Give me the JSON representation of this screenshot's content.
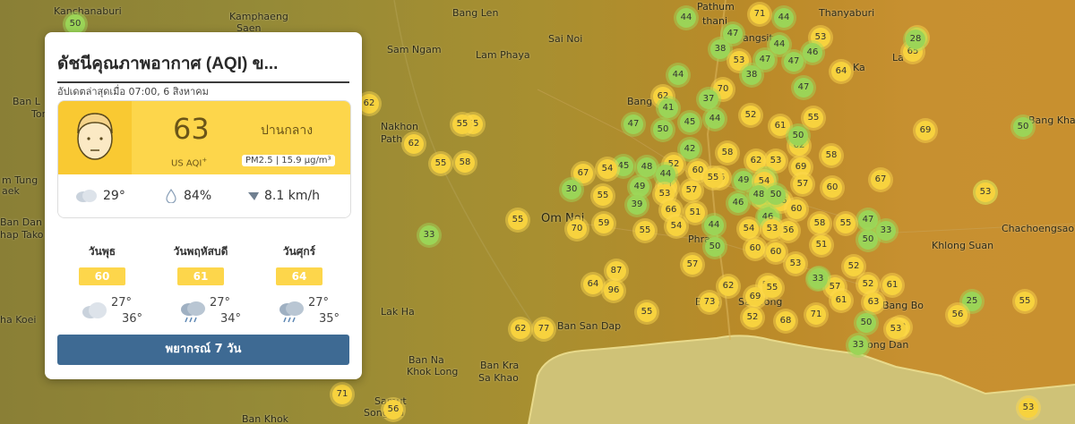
{
  "card": {
    "title": "ดัชนีคุณภาพอากาศ (AQI) ข...",
    "updated": "อัปเดตล่าสุดเมื่อ 07:00, 6 สิงหาคม",
    "aqi_value": "63",
    "aqi_unit": "US AQI",
    "aqi_unit_sup": "+",
    "aqi_level": "ปานกลาง",
    "pm_label": "PM2.5 | 15.9 µg/m³",
    "temperature": "29°",
    "humidity": "84%",
    "wind": "8.1 km/h",
    "forecast": [
      {
        "day": "วันพุธ",
        "aqi": "60",
        "high": "27°",
        "low": "36°",
        "icon": "cloud-icon"
      },
      {
        "day": "วันพฤหัสบดี",
        "aqi": "61",
        "high": "27°",
        "low": "34°",
        "icon": "rain-icon"
      },
      {
        "day": "วันศุกร์",
        "aqi": "64",
        "high": "27°",
        "low": "35°",
        "icon": "rain-icon"
      }
    ],
    "forecast_button": "พยากรณ์ 7 วัน",
    "colors": {
      "moderate": "#fdd64b",
      "good": "#9bd457",
      "button": "#3e6a93"
    }
  },
  "places": [
    {
      "name": "Kanchanaburi"
    },
    {
      "name": "Kamphaeng"
    },
    {
      "name": "Saen"
    },
    {
      "name": "Bang Len"
    },
    {
      "name": "Sam Ngam"
    },
    {
      "name": "Lam Phaya"
    },
    {
      "name": "Sai Noi"
    },
    {
      "name": "Pathum"
    },
    {
      "name": "thani"
    },
    {
      "name": "Thanyaburi"
    },
    {
      "name": "angsit"
    },
    {
      "name": "La"
    },
    {
      "name": "Ka"
    },
    {
      "name": "Ban L"
    },
    {
      "name": "Ton"
    },
    {
      "name": "Nakhon"
    },
    {
      "name": "Path"
    },
    {
      "name": "Bang P"
    },
    {
      "name": "Bang Khan"
    },
    {
      "name": "m Tung"
    },
    {
      "name": "aek"
    },
    {
      "name": "Ban Dan"
    },
    {
      "name": "hap Tako"
    },
    {
      "name": "Om Noi"
    },
    {
      "name": "Chachoengsao"
    },
    {
      "name": "Khlong Suan"
    },
    {
      "name": "ha Koei"
    },
    {
      "name": "Lak Ha"
    },
    {
      "name": "Ban San Dap"
    },
    {
      "name": "Bang Bo"
    },
    {
      "name": "ong Dan"
    },
    {
      "name": "Ban Na"
    },
    {
      "name": "Khok Long"
    },
    {
      "name": "Ban Kra"
    },
    {
      "name": "Sa Khao"
    },
    {
      "name": "Samut"
    },
    {
      "name": "Songkra"
    },
    {
      "name": "Ban Khok"
    },
    {
      "name": "Phra"
    },
    {
      "name": "Samrong"
    },
    {
      "name": "Bang"
    }
  ],
  "markers": [
    {
      "v": "50",
      "c": "g"
    },
    {
      "v": "44",
      "c": "g"
    },
    {
      "v": "71",
      "c": "m"
    },
    {
      "v": "44",
      "c": "g"
    },
    {
      "v": "47",
      "c": "g"
    },
    {
      "v": "44",
      "c": "g"
    },
    {
      "v": "53",
      "c": "m"
    },
    {
      "v": "38",
      "c": "g"
    },
    {
      "v": "53",
      "c": "m"
    },
    {
      "v": "47",
      "c": "g"
    },
    {
      "v": "38",
      "c": "g"
    },
    {
      "v": "47",
      "c": "g"
    },
    {
      "v": "46",
      "c": "g"
    },
    {
      "v": "64",
      "c": "m"
    },
    {
      "v": "65",
      "c": "m"
    },
    {
      "v": "44",
      "c": "g"
    },
    {
      "v": "70",
      "c": "m"
    },
    {
      "v": "47",
      "c": "g"
    },
    {
      "v": "62",
      "c": "m"
    },
    {
      "v": "37",
      "c": "g"
    },
    {
      "v": "41",
      "c": "g"
    },
    {
      "v": "44",
      "c": "g"
    },
    {
      "v": "52",
      "c": "m"
    },
    {
      "v": "61",
      "c": "m"
    },
    {
      "v": "55",
      "c": "m"
    },
    {
      "v": "55",
      "c": "m"
    },
    {
      "v": "47",
      "c": "g"
    },
    {
      "v": "50",
      "c": "g"
    },
    {
      "v": "45",
      "c": "g"
    },
    {
      "v": "62",
      "c": "m"
    },
    {
      "v": "69",
      "c": "m"
    },
    {
      "v": "50",
      "c": "g"
    },
    {
      "v": "42",
      "c": "g"
    },
    {
      "v": "58",
      "c": "m"
    },
    {
      "v": "62",
      "c": "m"
    },
    {
      "v": "53",
      "c": "m"
    },
    {
      "v": "58",
      "c": "m"
    },
    {
      "v": "45",
      "c": "g"
    },
    {
      "v": "48",
      "c": "g"
    },
    {
      "v": "52",
      "c": "m"
    },
    {
      "v": "60",
      "c": "m"
    },
    {
      "v": "67",
      "c": "m"
    },
    {
      "v": "54",
      "c": "m"
    },
    {
      "v": "49",
      "c": "g"
    },
    {
      "v": "51",
      "c": "m"
    },
    {
      "v": "44",
      "c": "g"
    },
    {
      "v": "66",
      "c": "m"
    },
    {
      "v": "69",
      "c": "m"
    },
    {
      "v": "50",
      "c": "g"
    },
    {
      "v": "30",
      "c": "g"
    },
    {
      "v": "55",
      "c": "m"
    },
    {
      "v": "49",
      "c": "g"
    },
    {
      "v": "54",
      "c": "m"
    },
    {
      "v": "57",
      "c": "m"
    },
    {
      "v": "55",
      "c": "m"
    },
    {
      "v": "46",
      "c": "g"
    },
    {
      "v": "57",
      "c": "m"
    },
    {
      "v": "60",
      "c": "m"
    },
    {
      "v": "67",
      "c": "m"
    },
    {
      "v": "36",
      "c": "g"
    },
    {
      "v": "53",
      "c": "m"
    },
    {
      "v": "55",
      "c": "m"
    },
    {
      "v": "39",
      "c": "g"
    },
    {
      "v": "66",
      "c": "m"
    },
    {
      "v": "51",
      "c": "m"
    },
    {
      "v": "46",
      "c": "g"
    },
    {
      "v": "48",
      "c": "g"
    },
    {
      "v": "56",
      "c": "m"
    },
    {
      "v": "60",
      "c": "m"
    },
    {
      "v": "47",
      "c": "g"
    },
    {
      "v": "70",
      "c": "m"
    },
    {
      "v": "59",
      "c": "m"
    },
    {
      "v": "33",
      "c": "g"
    },
    {
      "v": "55",
      "c": "m"
    },
    {
      "v": "54",
      "c": "m"
    },
    {
      "v": "44",
      "c": "g"
    },
    {
      "v": "54",
      "c": "m"
    },
    {
      "v": "46",
      "c": "g"
    },
    {
      "v": "56",
      "c": "m"
    },
    {
      "v": "58",
      "c": "m"
    },
    {
      "v": "55",
      "c": "m"
    },
    {
      "v": "50",
      "c": "g"
    },
    {
      "v": "33",
      "c": "g"
    },
    {
      "v": "53",
      "c": "m"
    },
    {
      "v": "55",
      "c": "m"
    },
    {
      "v": "55",
      "c": "m"
    },
    {
      "v": "50",
      "c": "g"
    },
    {
      "v": "60",
      "c": "m"
    },
    {
      "v": "51",
      "c": "m"
    },
    {
      "v": "57",
      "c": "m"
    },
    {
      "v": "60",
      "c": "m"
    },
    {
      "v": "53",
      "c": "m"
    },
    {
      "v": "52",
      "c": "m"
    },
    {
      "v": "87",
      "c": "m"
    },
    {
      "v": "64",
      "c": "m"
    },
    {
      "v": "96",
      "c": "m"
    },
    {
      "v": "62",
      "c": "m"
    },
    {
      "v": "52",
      "c": "m"
    },
    {
      "v": "33",
      "c": "g"
    },
    {
      "v": "57",
      "c": "m"
    },
    {
      "v": "52",
      "c": "m"
    },
    {
      "v": "61",
      "c": "m"
    },
    {
      "v": "69",
      "c": "m"
    },
    {
      "v": "61",
      "c": "m"
    },
    {
      "v": "63",
      "c": "m"
    },
    {
      "v": "73",
      "c": "m"
    },
    {
      "v": "52",
      "c": "m"
    },
    {
      "v": "68",
      "c": "m"
    },
    {
      "v": "71",
      "c": "m"
    },
    {
      "v": "50",
      "c": "g"
    },
    {
      "v": "63",
      "c": "m"
    },
    {
      "v": "55",
      "c": "m"
    },
    {
      "v": "25",
      "c": "g"
    },
    {
      "v": "56",
      "c": "m"
    },
    {
      "v": "55",
      "c": "m"
    },
    {
      "v": "62",
      "c": "m"
    },
    {
      "v": "77",
      "c": "m"
    },
    {
      "v": "33",
      "c": "g"
    },
    {
      "v": "71",
      "c": "m"
    },
    {
      "v": "56",
      "c": "m"
    },
    {
      "v": "62",
      "c": "m"
    },
    {
      "v": "55",
      "c": "m"
    },
    {
      "v": "62",
      "c": "m"
    },
    {
      "v": "55",
      "c": "m"
    },
    {
      "v": "53",
      "c": "m"
    },
    {
      "v": "58",
      "c": "m"
    },
    {
      "v": "50",
      "c": "g"
    },
    {
      "v": "33",
      "c": "g"
    },
    {
      "v": "69",
      "c": "m"
    },
    {
      "v": "50",
      "c": "g"
    },
    {
      "v": "53",
      "c": "m"
    },
    {
      "v": "28",
      "c": "g"
    },
    {
      "v": "53",
      "c": "m"
    }
  ]
}
